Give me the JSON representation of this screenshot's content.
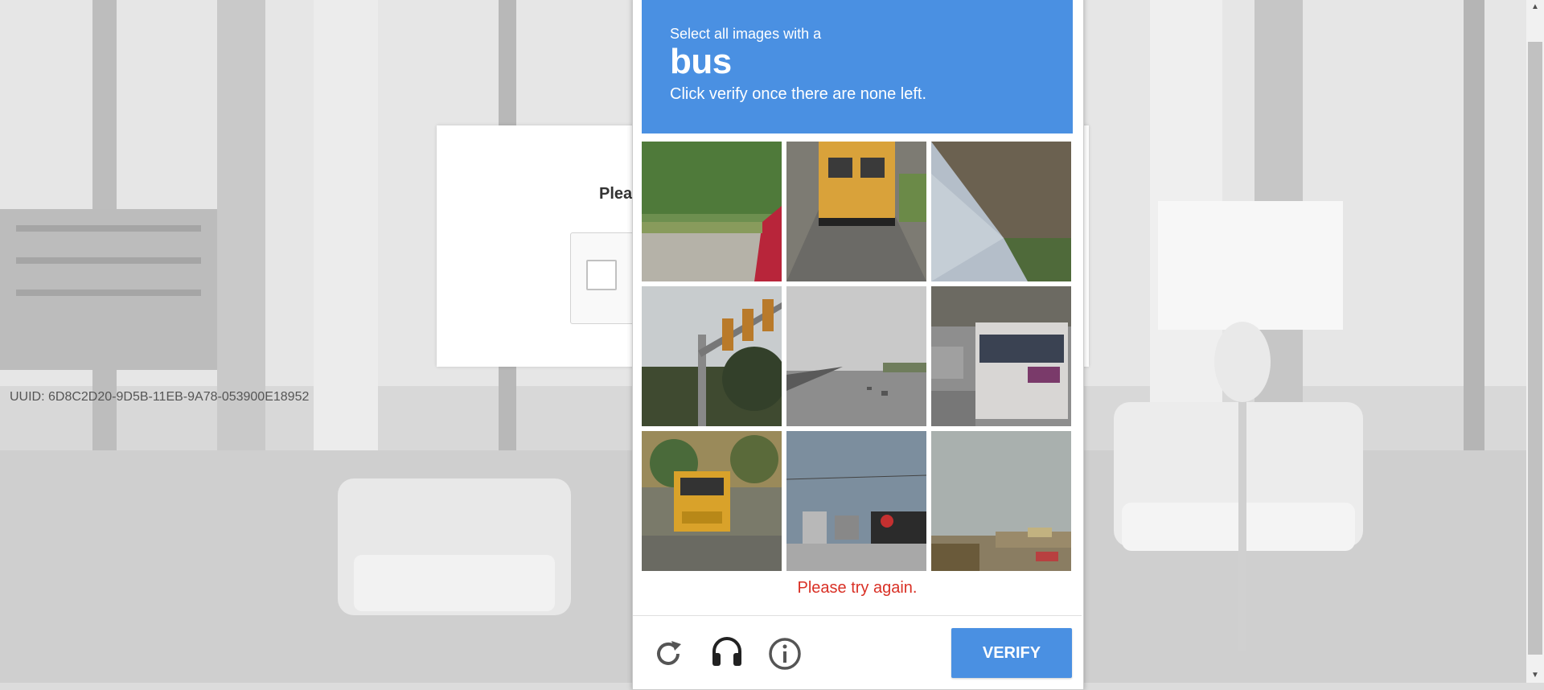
{
  "page": {
    "heading": "Plea",
    "uuid": "UUID: 6D8C2D20-9D5B-11EB-9A78-053900E18952"
  },
  "challenge": {
    "instruction_small": "Select all images with a",
    "target": "bus",
    "instruction_sub": "Click verify once there are none left.",
    "error": "Please try again.",
    "verify_label": "VERIFY",
    "tiles": [
      {
        "name": "tile-bushes-car"
      },
      {
        "name": "tile-school-bus-rear"
      },
      {
        "name": "tile-awning"
      },
      {
        "name": "tile-traffic-light"
      },
      {
        "name": "tile-highway"
      },
      {
        "name": "tile-city-bus"
      },
      {
        "name": "tile-school-bus-front"
      },
      {
        "name": "tile-street-sign"
      },
      {
        "name": "tile-street-horizon"
      }
    ],
    "icons": [
      "reload-icon",
      "headphones-icon",
      "info-icon"
    ]
  },
  "colors": {
    "header": "#4a90e2",
    "error": "#d93025",
    "verify": "#4a90e2"
  }
}
